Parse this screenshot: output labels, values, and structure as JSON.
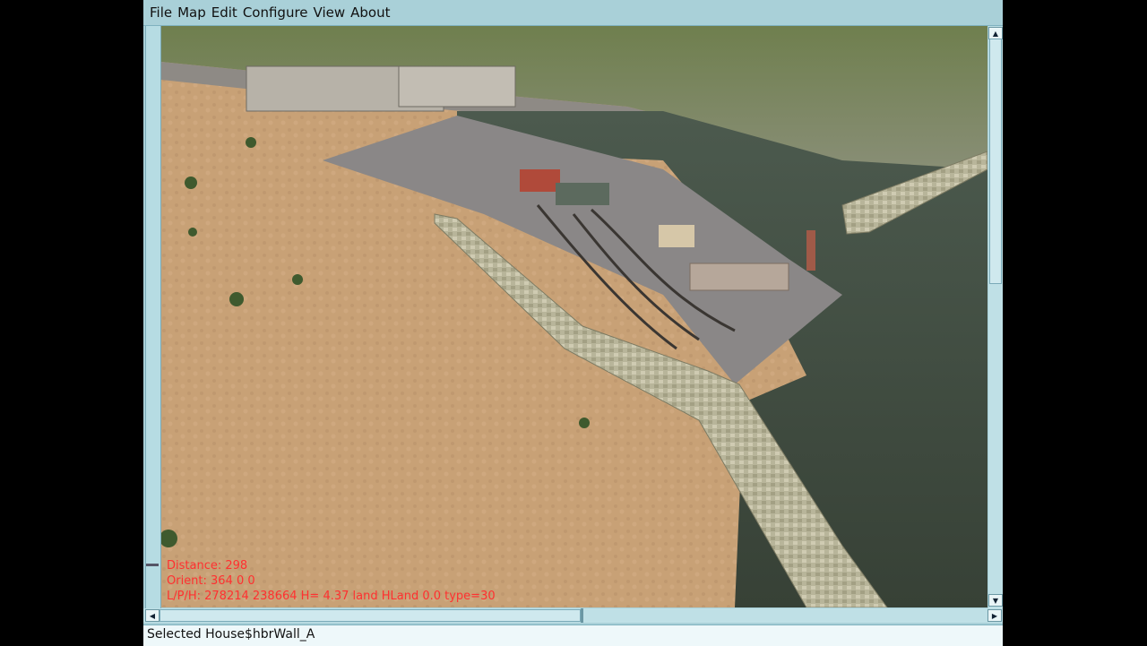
{
  "menu": {
    "items": [
      "File",
      "Map",
      "Edit",
      "Configure",
      "View",
      "About"
    ]
  },
  "viewport": {
    "overlay": {
      "distance": "Distance: 298",
      "orient": "Orient: 364 0 0",
      "position": "L/P/H: 278214 238664 H= 4.37 land HLand 0.0 type=30"
    }
  },
  "scrollbars": {
    "up_arrow": "▲",
    "down_arrow": "▼",
    "left_arrow": "◀",
    "right_arrow": "▶"
  },
  "status": {
    "text": "Selected House$hbrWall_A"
  },
  "colors": {
    "frame": "#a9d0d8",
    "overlay_text": "#ff3030",
    "water": "#3e4a40",
    "ground": "#c9a27a"
  }
}
